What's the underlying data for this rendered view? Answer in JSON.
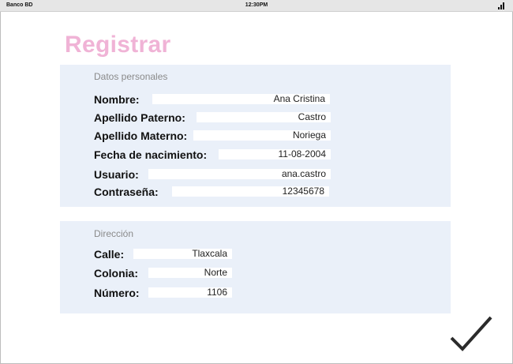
{
  "status_bar": {
    "carrier": "Banco BD",
    "time": "12:30PM",
    "signal_icon": "signal-bars-icon"
  },
  "page": {
    "title": "Registrar",
    "title_color": "#f0b3d6",
    "panel_color": "#eaf0f9"
  },
  "personal": {
    "section_title": "Datos personales",
    "fields": [
      {
        "label": "Nombre:",
        "value": "Ana Cristina"
      },
      {
        "label": "Apellido Paterno:",
        "value": "Castro"
      },
      {
        "label": "Apellido Materno:",
        "value": "Noriega"
      },
      {
        "label": "Fecha de nacimiento:",
        "value": "11-08-2004"
      },
      {
        "label": "Usuario:",
        "value": "ana.castro"
      },
      {
        "label": "Contraseña:",
        "value": "12345678"
      }
    ]
  },
  "address": {
    "section_title": "Dirección",
    "fields": [
      {
        "label": "Calle:",
        "value": "Tlaxcala"
      },
      {
        "label": "Colonia:",
        "value": "Norte"
      },
      {
        "label": "Número:",
        "value": "1106"
      }
    ]
  },
  "actions": {
    "confirm_icon": "checkmark-icon"
  }
}
